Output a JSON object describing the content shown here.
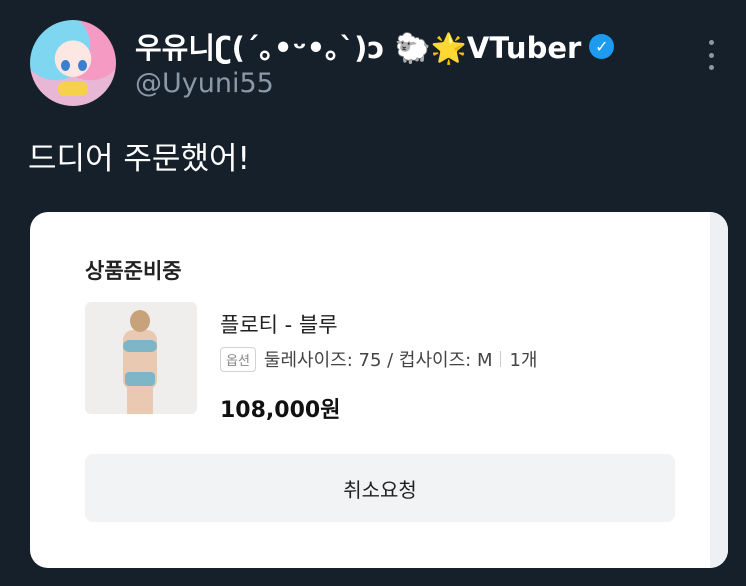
{
  "tweet": {
    "display_name": "우유니ʗ(´｡•ᵕ•｡`)ɔ 🐑🌟VTuber",
    "verified_mark": "✓",
    "handle": "@Uyuni55",
    "text": "드디어 주문했어!"
  },
  "order_card": {
    "status": "상품준비중",
    "product_name": "플로티 - 블루",
    "option_badge": "옵션",
    "option_text": "둘레사이즈: 75 / 컵사이즈: M",
    "quantity": "1개",
    "price": "108,000원",
    "cancel_button": "취소요청"
  },
  "colors": {
    "background": "#15202b",
    "verified": "#1d9bf0",
    "handle": "#8b98a5"
  },
  "icons": {
    "verified": "verified-badge-icon",
    "more": "more-options-icon"
  }
}
